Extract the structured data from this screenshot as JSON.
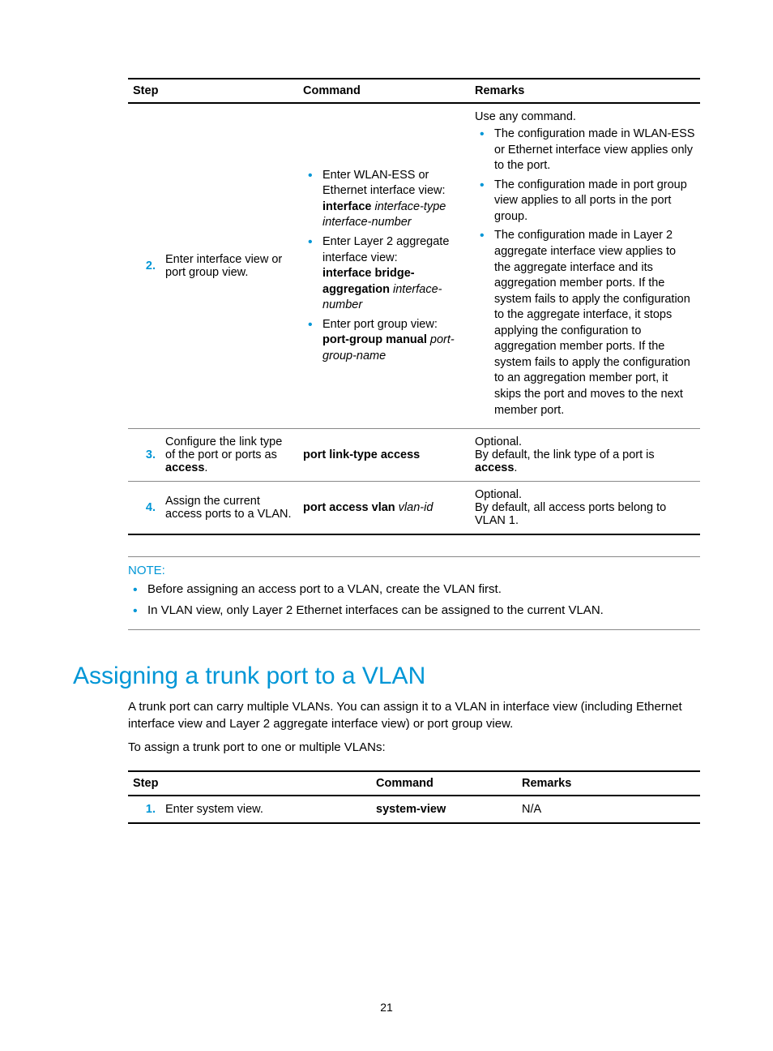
{
  "table1": {
    "headers": {
      "step": "Step",
      "command": "Command",
      "remarks": "Remarks"
    },
    "rows": [
      {
        "num": "2.",
        "desc": "Enter interface view or port group view.",
        "cmd": [
          {
            "lead": "Enter WLAN-ESS or Ethernet interface view:",
            "b": "interface",
            "i": " interface-type interface-number"
          },
          {
            "lead": "Enter Layer 2 aggregate interface view:",
            "b": "interface bridge-aggregation",
            "i": " interface-number"
          },
          {
            "lead": "Enter port group view:",
            "b": "port-group manual",
            "i": " port-group-name"
          }
        ],
        "remarks_lead": "Use any command.",
        "remarks": [
          "The configuration made in WLAN-ESS or Ethernet interface view applies only to the port.",
          "The configuration made in port group view applies to all ports in the port group.",
          "The configuration made in Layer 2 aggregate interface view applies to the aggregate interface and its aggregation member ports. If the system fails to apply the configuration to the aggregate interface, it stops applying the configuration to aggregation member ports. If the system fails to apply the configuration to an aggregation member port, it skips the port and moves to the next member port."
        ]
      },
      {
        "num": "3.",
        "desc_pre": "Configure the link type of the port or ports as ",
        "desc_bold": "access",
        "desc_post": ".",
        "cmd_b": "port link-type access",
        "remarks_l1": "Optional.",
        "remarks_l2_pre": "By default, the link type of a port is ",
        "remarks_l2_bold": "access",
        "remarks_l2_post": "."
      },
      {
        "num": "4.",
        "desc": "Assign the current access ports to a VLAN.",
        "cmd_b": "port access vlan",
        "cmd_i": " vlan-id",
        "remarks_l1": "Optional.",
        "remarks_l2": "By default, all access ports belong to VLAN 1."
      }
    ]
  },
  "note": {
    "label": "NOTE:",
    "items": [
      "Before assigning an access port to a VLAN, create the VLAN first.",
      "In VLAN view, only Layer 2 Ethernet interfaces can be assigned to the current VLAN."
    ]
  },
  "section": {
    "title": "Assigning a trunk port to a VLAN",
    "para1": "A trunk port can carry multiple VLANs. You can assign it to a VLAN in interface view (including Ethernet interface view and Layer 2 aggregate interface view) or port group view.",
    "para2": "To assign a trunk port to one or multiple VLANs:"
  },
  "table2": {
    "headers": {
      "step": "Step",
      "command": "Command",
      "remarks": "Remarks"
    },
    "row": {
      "num": "1.",
      "desc": "Enter system view.",
      "cmd": "system-view",
      "remarks": "N/A"
    }
  },
  "pagenum": "21"
}
